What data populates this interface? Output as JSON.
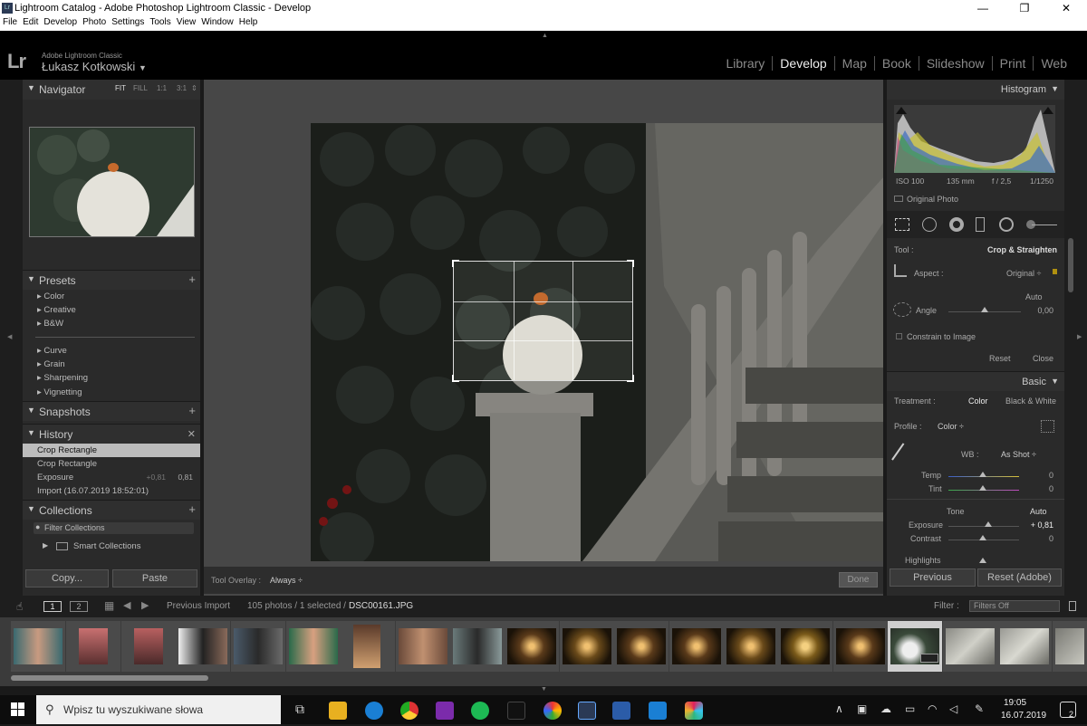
{
  "window": {
    "title": "Lightroom Catalog - Adobe Photoshop Lightroom Classic - Develop",
    "controls": [
      "—",
      "❐",
      "✕"
    ]
  },
  "menu": [
    "File",
    "Edit",
    "Develop",
    "Photo",
    "Settings",
    "Tools",
    "View",
    "Window",
    "Help"
  ],
  "identity": {
    "logo": "Lr",
    "product": "Adobe Lightroom Classic",
    "user": "Łukasz Kotkowski",
    "caret": "▼"
  },
  "modules": [
    {
      "label": "Library",
      "active": false
    },
    {
      "label": "Develop",
      "active": true
    },
    {
      "label": "Map",
      "active": false
    },
    {
      "label": "Book",
      "active": false
    },
    {
      "label": "Slideshow",
      "active": false
    },
    {
      "label": "Print",
      "active": false
    },
    {
      "label": "Web",
      "active": false
    }
  ],
  "navigator": {
    "title": "Navigator",
    "zoom": [
      "FIT",
      "FILL",
      "1:1",
      "3:1"
    ],
    "arrow": "⇕"
  },
  "presets": {
    "title": "Presets",
    "items": [
      "Color",
      "Creative",
      "B&W",
      "Curve",
      "Grain",
      "Sharpening",
      "Vignetting"
    ]
  },
  "snapshots": {
    "title": "Snapshots"
  },
  "history": {
    "title": "History",
    "items": [
      {
        "label": "Crop Rectangle",
        "v1": "",
        "v2": "",
        "selected": true
      },
      {
        "label": "Crop Rectangle",
        "v1": "",
        "v2": "",
        "selected": false
      },
      {
        "label": "Exposure",
        "v1": "+0,81",
        "v2": "0,81",
        "selected": false
      },
      {
        "label": "Import (16.07.2019 18:52:01)",
        "v1": "",
        "v2": "",
        "selected": false
      }
    ]
  },
  "collections": {
    "title": "Collections",
    "filter": "Filter Collections",
    "smart": "Smart Collections"
  },
  "left_buttons": {
    "copy": "Copy...",
    "paste": "Paste"
  },
  "toolbar": {
    "overlay_label": "Tool Overlay :",
    "overlay_value": "Always ÷",
    "done": "Done"
  },
  "histogram": {
    "title": "Histogram",
    "iso": "ISO 100",
    "focal": "135 mm",
    "aperture": "f / 2,5",
    "shutter": "1/1250",
    "original": "Original Photo"
  },
  "crop": {
    "tool_label": "Tool :",
    "tool_value": "Crop & Straighten",
    "aspect_label": "Aspect :",
    "aspect_value": "Original ÷",
    "auto": "Auto",
    "angle_label": "Angle",
    "angle_value": "0,00",
    "constrain": "Constrain to Image",
    "reset": "Reset",
    "close": "Close"
  },
  "basic": {
    "title": "Basic",
    "treatment_label": "Treatment :",
    "color": "Color",
    "bw": "Black & White",
    "profile_label": "Profile :",
    "profile_value": "Color ÷",
    "wb_label": "WB :",
    "wb_value": "As Shot ÷",
    "temp_label": "Temp",
    "temp_value": "0",
    "tint_label": "Tint",
    "tint_value": "0",
    "tone": "Tone",
    "tone_auto": "Auto",
    "exposure_label": "Exposure",
    "exposure_value": "+ 0,81",
    "contrast_label": "Contrast",
    "contrast_value": "0",
    "highlights_label": "Highlights"
  },
  "right_buttons": {
    "previous": "Previous",
    "reset": "Reset (Adobe)"
  },
  "filmbar": {
    "page1": "1",
    "page2": "2",
    "source": "Previous Import",
    "info": "105 photos / 1 selected /",
    "file": "DSC00161.JPG",
    "filter_label": "Filter :",
    "filter_value": "Filters Off"
  },
  "taskbar": {
    "search_placeholder": "Wpisz tu wyszukiwane słowa",
    "time": "19:05",
    "date": "16.07.2019",
    "notif": "2"
  }
}
